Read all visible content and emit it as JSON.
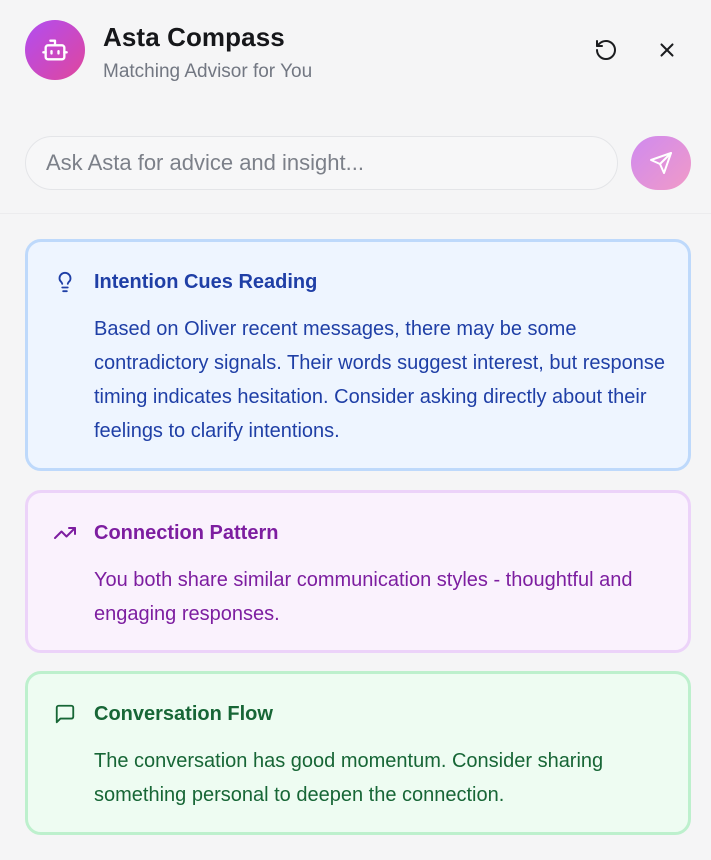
{
  "header": {
    "title": "Asta Compass",
    "subtitle": "Matching Advisor for You",
    "avatar_icon": "robot-icon",
    "actions": [
      {
        "name": "refresh",
        "icon": "refresh-icon"
      },
      {
        "name": "close",
        "icon": "close-icon"
      }
    ]
  },
  "search": {
    "value": "",
    "placeholder": "Ask Asta for advice and insight...",
    "send_icon": "send-icon"
  },
  "cards": [
    {
      "icon": "lightbulb-icon",
      "title": "Intention Cues Reading",
      "body": "Based on Oliver recent messages, there may be some contradictory signals. Their words suggest interest, but response timing indicates hesitation. Consider asking directly about their feelings to clarify intentions.",
      "color": "#1f3fa6",
      "background": "#eef5ff",
      "border": "#bed9fb"
    },
    {
      "icon": "trending-up-icon",
      "title": "Connection Pattern",
      "body": "You both share similar communication styles - thoughtful and engaging responses.",
      "color": "#7d1ea0",
      "background": "#faf2fd",
      "border": "#ecd3f9"
    },
    {
      "icon": "message-square-icon",
      "title": "Conversation Flow",
      "body": "The conversation has good momentum. Consider sharing something personal to deepen the connection.",
      "color": "#176636",
      "background": "#eefcf2",
      "border": "#bdf0cd"
    }
  ],
  "colors": {
    "accent_gradient_start": "#b14df2",
    "accent_gradient_end": "#e0469c"
  }
}
